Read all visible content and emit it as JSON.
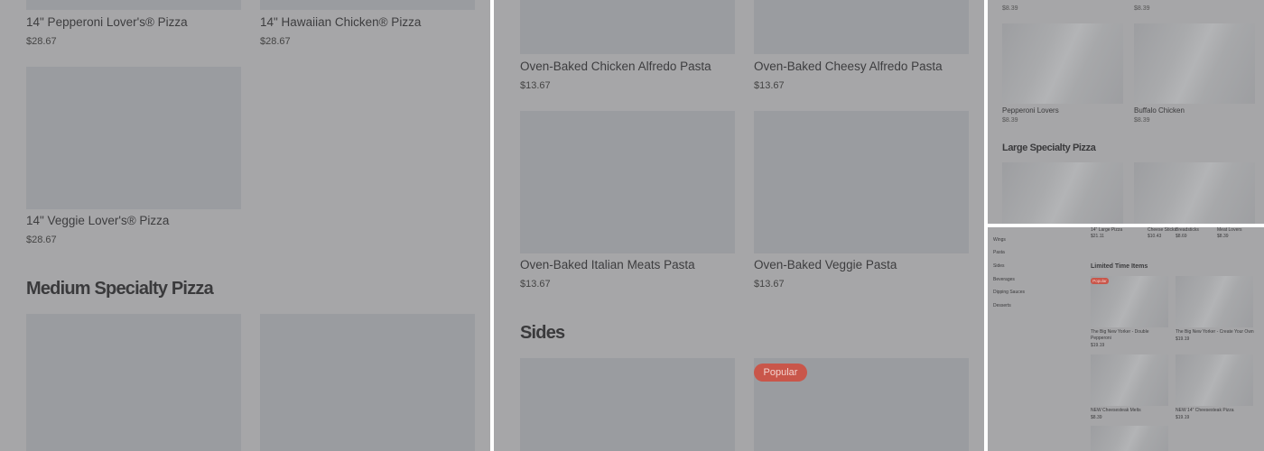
{
  "panel1": {
    "items": [
      {
        "name": "14\" Pepperoni Lover's® Pizza",
        "price": "$28.67"
      },
      {
        "name": "14\" Hawaiian Chicken® Pizza",
        "price": "$28.67"
      },
      {
        "name": "14\" Veggie Lover's® Pizza",
        "price": "$28.67"
      }
    ],
    "section_heading": "Medium Specialty Pizza"
  },
  "panel2": {
    "items": [
      {
        "name": "Oven-Baked Chicken Alfredo Pasta",
        "price": "$13.67"
      },
      {
        "name": "Oven-Baked Cheesy Alfredo Pasta",
        "price": "$13.67"
      },
      {
        "name": "Oven-Baked Italian Meats Pasta",
        "price": "$13.67"
      },
      {
        "name": "Oven-Baked Veggie Pasta",
        "price": "$13.67"
      }
    ],
    "section_heading": "Sides",
    "badge": "Popular"
  },
  "panel3": {
    "top_prices": [
      "$8.39",
      "$8.39"
    ],
    "items": [
      {
        "name": "Pepperoni Lovers",
        "price": "$8.39"
      },
      {
        "name": "Buffalo Chicken",
        "price": "$8.39"
      }
    ],
    "section_heading": "Large Specialty Pizza"
  },
  "panel4": {
    "sidebar": [
      "Wings",
      "Pasta",
      "Sides",
      "Beverages",
      "Dipping Sauces",
      "Desserts"
    ],
    "top_items": [
      {
        "name": "14\" Large Pizza",
        "price": "$21.11"
      },
      {
        "name": "Cheese Sticks",
        "price": "$10.43"
      },
      {
        "name": "Breadsticks",
        "price": "$8.69"
      },
      {
        "name": "Meat Lovers",
        "price": "$8.39"
      }
    ],
    "section_heading": "Limited Time Items",
    "badge": "Popular",
    "items": [
      {
        "name": "The Big New Yorker - Double Pepperoni",
        "price": "$19.19"
      },
      {
        "name": "The Big New Yorker - Create Your Own",
        "price": "$19.19"
      },
      {
        "name": "NEW Cheesesteak Melts",
        "price": "$8.39"
      },
      {
        "name": "NEW 14\" Cheesesteak Pizza",
        "price": "$19.19"
      }
    ]
  },
  "colors": {
    "overlay": "#a6a6a8",
    "image_placeholder": "#9a9ca0",
    "badge": "#c9564a"
  }
}
